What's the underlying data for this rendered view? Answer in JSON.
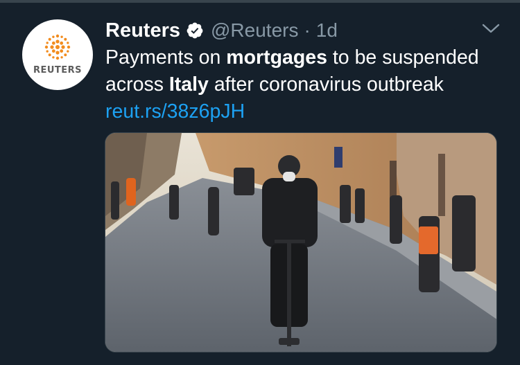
{
  "tweet": {
    "avatar": {
      "text": "REUTERS",
      "icon": "reuters-logo-icon",
      "accent": "#f28c1e"
    },
    "author_name": "Reuters",
    "verified_icon": "verified-badge-icon",
    "handle": "@Reuters",
    "separator": "·",
    "time": "1d",
    "menu_icon": "chevron-down-icon",
    "text": {
      "p1": "Payments on ",
      "b1": "mortgages",
      "p2": " to be suspended across ",
      "b2": "Italy",
      "p3": " after coronavirus outbreak ",
      "link": "reut.rs/38z6pJH"
    },
    "media": {
      "description_icon": "photo-icon"
    }
  },
  "colors": {
    "background": "#15202b",
    "link": "#1da1f2",
    "muted": "#8899a6",
    "divider": "#38444d"
  }
}
